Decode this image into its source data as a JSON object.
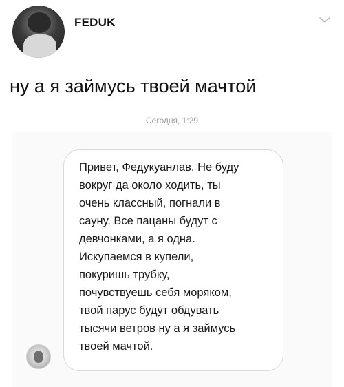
{
  "post": {
    "author": "FEDUK",
    "text": "ну а я займусь твоей мачтой",
    "avatar_icon": "user-photo-icon",
    "menu_icon": "chevron-down-icon"
  },
  "chat": {
    "timestamp": "Сегодня, 1:29",
    "sender_avatar_icon": "sender-photo-icon",
    "message_lines": [
      "Привет, Федукуанлав. Не буду",
      "вокруг да около ходить, ты",
      "очень классный, погнали в",
      "сауну. Все пацаны будут с",
      "девчонками, а я одна.",
      "Искупаемся в купели,",
      "покуришь трубку,",
      "почувствуешь себя моряком,",
      "твой парус будут обдувать",
      "тысячи ветров ну а я займусь",
      "твоей мачтой."
    ]
  }
}
